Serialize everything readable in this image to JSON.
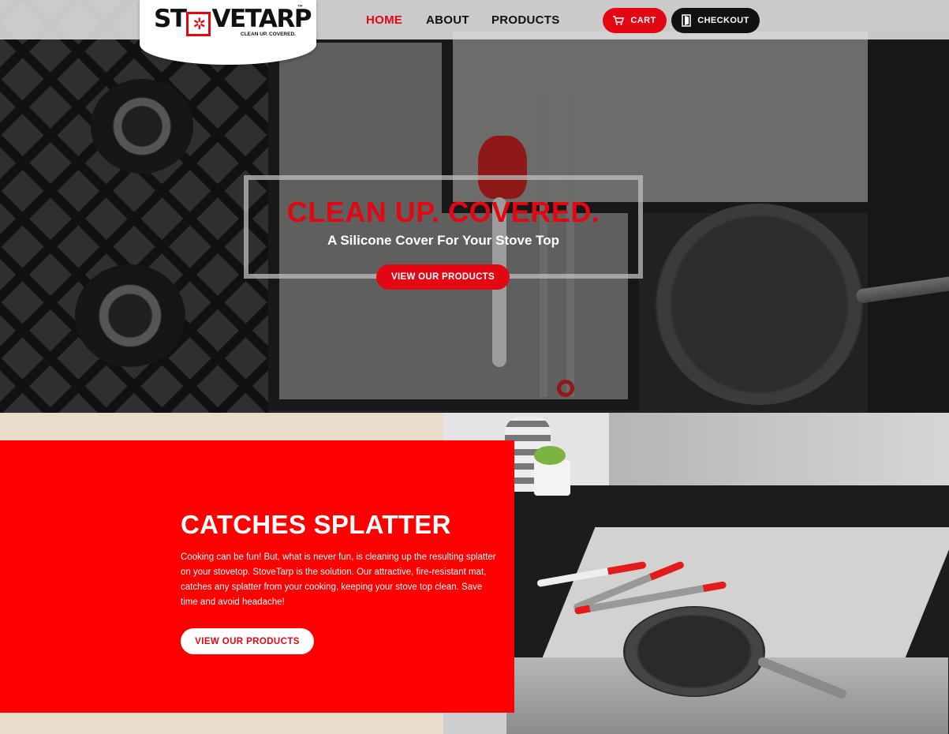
{
  "brand": {
    "logo_prefix": "ST",
    "logo_suffix": "VETARP",
    "logo_tm": "™",
    "tagline": "CLEAN UP. COVERED.",
    "accent_color": "#e30613"
  },
  "nav": {
    "links": [
      {
        "label": "HOME",
        "active": true
      },
      {
        "label": "ABOUT",
        "active": false
      },
      {
        "label": "PRODUCTS",
        "active": false
      }
    ],
    "cart_label": "CART",
    "cart_icon": "cart-icon",
    "checkout_label": "CHECKOUT",
    "checkout_icon": "door-exit-icon"
  },
  "hero": {
    "title": "CLEAN UP. COVERED.",
    "subtitle": "A Silicone Cover For Your Stove Top",
    "button_label": "VIEW OUR PRODUCTS"
  },
  "feature": {
    "title": "CATCHES SPLATTER",
    "body": "Cooking can be fun! But, what is never fun, is cleaning up the resulting splatter on your stovetop. StoveTarp is the solution. Our attractive, fire-resistant mat, catches any splatter from your cooking, keeping your stove top clean. Save time and avoid headache!",
    "button_label": "VIEW OUR PRODUCTS",
    "panel_color": "#ff0000"
  }
}
